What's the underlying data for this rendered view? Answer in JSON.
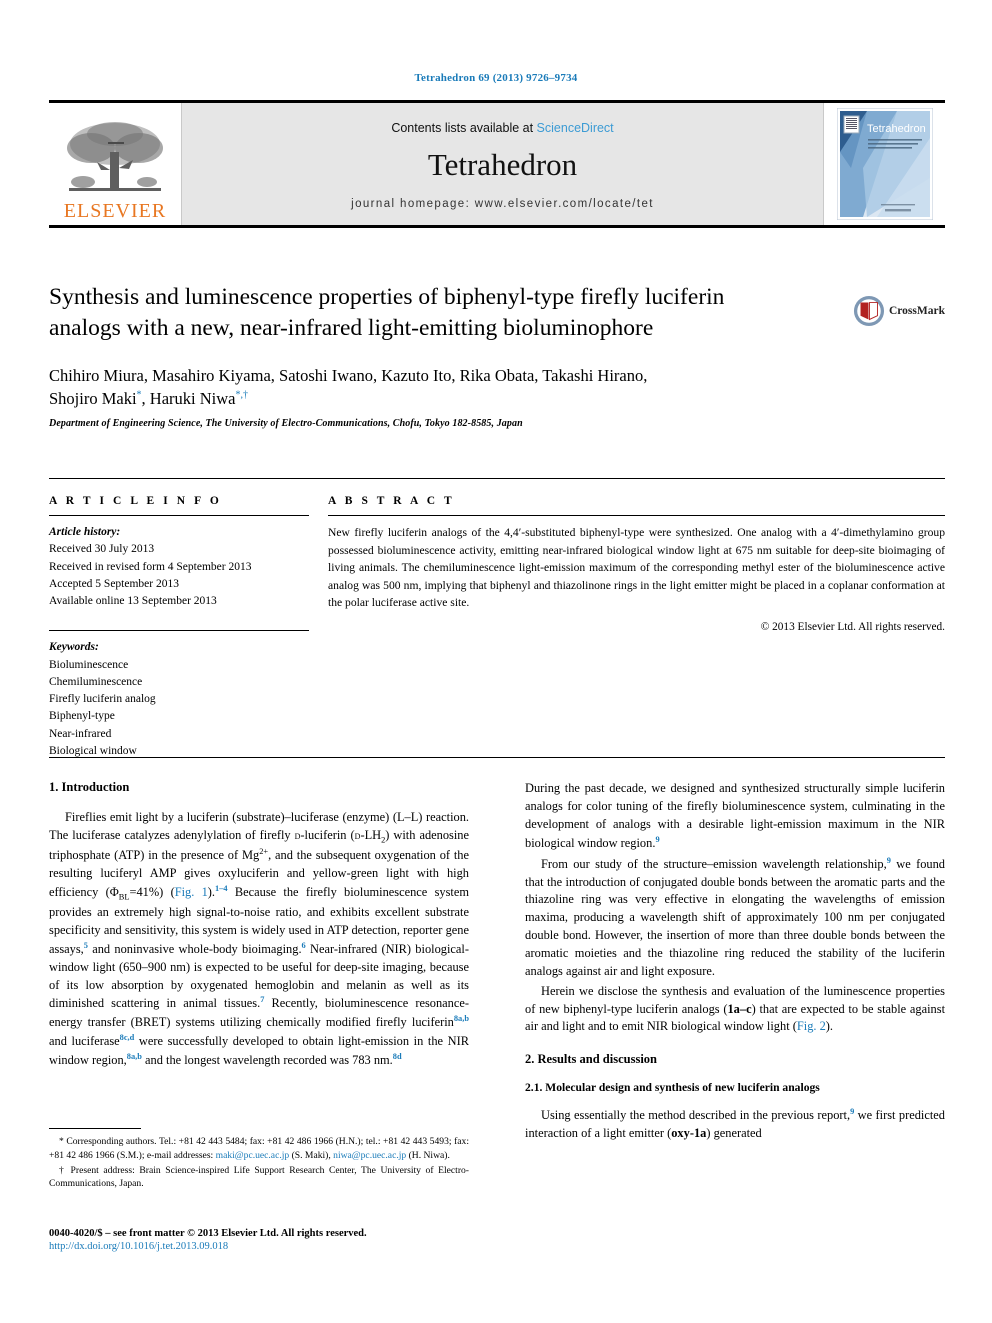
{
  "citation": "Tetrahedron 69 (2013) 9726–9734",
  "masthead": {
    "contents_prefix": "Contents lists available at ",
    "sciencedirect": "ScienceDirect",
    "journal_name": "Tetrahedron",
    "homepage": "journal homepage: www.elsevier.com/locate/tet",
    "publisher_wordmark": "ELSEVIER",
    "cover_title": "Tetrahedron",
    "accent_blue": "#1a7bb9",
    "elsevier_orange": "#e87722",
    "masthead_bg": "#e6e6e6"
  },
  "article": {
    "title": "Synthesis and luminescence properties of biphenyl-type firefly luciferin analogs with a new, near-infrared light-emitting bioluminophore",
    "crossmark_label": "CrossMark",
    "authors_line1": "Chihiro Miura, Masahiro Kiyama, Satoshi Iwano, Kazuto Ito, Rika Obata, Takashi Hirano,",
    "authors_line2_a": "Shojiro Maki",
    "authors_line2_mark1": "*",
    "authors_line2_b": ", Haruki Niwa",
    "authors_line2_mark2": "*,†",
    "affiliation": "Department of Engineering Science, The University of Electro-Communications, Chofu, Tokyo 182-8585, Japan"
  },
  "info": {
    "heading": "A R T I C L E   I N F O",
    "history_label": "Article history:",
    "history": [
      "Received 30 July 2013",
      "Received in revised form 4 September 2013",
      "Accepted 5 September 2013",
      "Available online 13 September 2013"
    ],
    "keywords_label": "Keywords:",
    "keywords": [
      "Bioluminescence",
      "Chemiluminescence",
      "Firefly luciferin analog",
      "Biphenyl-type",
      "Near-infrared",
      "Biological window"
    ]
  },
  "abstract": {
    "heading": "A B S T R A C T",
    "text": "New firefly luciferin analogs of the 4,4′-substituted biphenyl-type were synthesized. One analog with a 4′-dimethylamino group possessed bioluminescence activity, emitting near-infrared biological window light at 675 nm suitable for deep-site bioimaging of living animals. The chemiluminescence light-emission maximum of the corresponding methyl ester of the bioluminescence active analog was 500 nm, implying that biphenyl and thiazolinone rings in the light emitter might be placed in a coplanar conformation at the polar luciferase active site.",
    "copyright": "© 2013 Elsevier Ltd. All rights reserved."
  },
  "body": {
    "intro_heading": "1. Introduction",
    "results_heading": "2. Results and discussion",
    "results_sub_heading": "2.1. Molecular design and synthesis of new luciferin analogs",
    "left_p1_a": "Fireflies emit light by a luciferin (substrate)–luciferase (enzyme) (L–L) reaction. The luciferase catalyzes adenylylation of firefly ",
    "left_p1_sc1": "d",
    "left_p1_b": "-luciferin (",
    "left_p1_sc2": "d",
    "left_p1_c": "-LH",
    "left_p1_sub1": "2",
    "left_p1_d": ") with adenosine triphosphate (ATP) in the presence of Mg",
    "left_p1_sup1": "2+",
    "left_p1_e": ", and the subsequent oxygenation of the resulting luciferyl AMP gives oxyluciferin and yellow-green light with high efficiency (Φ",
    "left_p1_sub2": "BL",
    "left_p1_f": "=41%) (",
    "left_p1_fig1": "Fig. 1",
    "left_p1_g": ").",
    "left_p1_ref1": "1–4",
    "left_p1_h": " Because the firefly bioluminescence system provides an extremely high signal-to-noise ratio, and exhibits excellent substrate specificity and sensitivity, this system is widely used in ATP detection, reporter gene assays,",
    "left_p1_ref2": "5",
    "left_p1_i": " and noninvasive whole-body bioimaging.",
    "left_p1_ref3": "6",
    "left_p1_j": " Near-infrared (NIR) biological-window light (650–900 nm) is expected to be useful for deep-site imaging, because of its low absorption by oxygenated hemoglobin and melanin as well as its diminished scattering in animal tissues.",
    "left_p1_ref4": "7",
    "left_p1_k": " Recently, bioluminescence resonance-energy transfer (BRET) systems utilizing chemically modified firefly luciferin",
    "left_p1_ref5": "8a,b",
    "left_p1_l": " and luciferase",
    "left_p1_ref6": "8c,d",
    "left_p1_m": " were successfully developed to obtain light-emission in the NIR window region,",
    "left_p1_ref7": "8a,b",
    "left_p1_n": " and the longest wavelength recorded was 783 nm.",
    "left_p1_ref8": "8d",
    "right_p1_a": "During the past decade, we designed and synthesized structurally simple luciferin analogs for color tuning of the firefly bioluminescence system, culminating in the development of analogs with a desirable light-emission maximum in the NIR biological window region.",
    "right_p1_ref": "9",
    "right_p2_a": "From our study of the structure–emission wavelength relationship,",
    "right_p2_ref": "9",
    "right_p2_b": " we found that the introduction of conjugated double bonds between the aromatic parts and the thiazoline ring was very effective in elongating the wavelengths of emission maxima, producing a wavelength shift of approximately 100 nm per conjugated double bond. However, the insertion of more than three double bonds between the aromatic moieties and the thiazoline ring reduced the stability of the luciferin analogs against air and light exposure.",
    "right_p3_a": "Herein we disclose the synthesis and evaluation of the luminescence properties of new biphenyl-type luciferin analogs (",
    "right_p3_bold1": "1a–c",
    "right_p3_b": ") that are expected to be stable against air and light and to emit NIR biological window light (",
    "right_p3_fig2": "Fig. 2",
    "right_p3_c": ").",
    "right_p4_a": "Using essentially the method described in the previous report,",
    "right_p4_ref": "9",
    "right_p4_b": " we first predicted interaction of a light emitter (",
    "right_p4_bold1": "oxy-1a",
    "right_p4_c": ") generated"
  },
  "footnotes": {
    "star_mark": "*",
    "star_a": " Corresponding authors. Tel.: +81 42 443 5484; fax: +81 42 486 1966 (H.N.); tel.: +81 42 443 5493; fax: +81 42 486 1966 (S.M.); e-mail addresses: ",
    "star_mail1": "maki@pc.uec.ac.jp",
    "star_b": " (S. Maki), ",
    "star_mail2": "niwa@pc.uec.ac.jp",
    "star_c": " (H. Niwa).",
    "dagger_mark": "†",
    "dagger_text": " Present address: Brain Science-inspired Life Support Research Center, The University of Electro-Communications, Japan."
  },
  "footer": {
    "issn_line": "0040-4020/$ – see front matter © 2013 Elsevier Ltd. All rights reserved.",
    "doi": "http://dx.doi.org/10.1016/j.tet.2013.09.018"
  }
}
